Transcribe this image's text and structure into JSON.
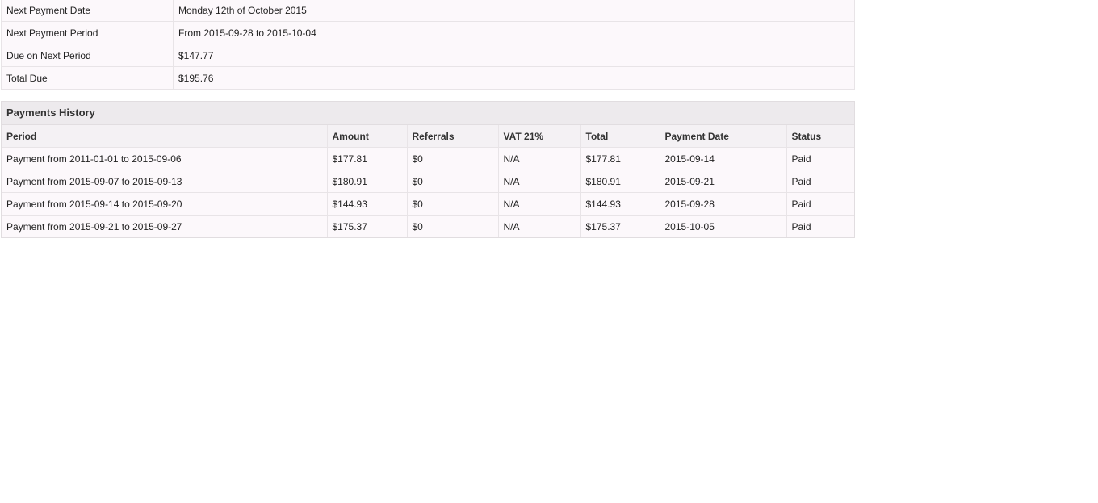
{
  "summary": {
    "rows": [
      {
        "label": "Next Payment Date",
        "value": "Monday 12th of October 2015"
      },
      {
        "label": "Next Payment Period",
        "value": "From 2015-09-28 to 2015-10-04"
      },
      {
        "label": "Due on Next Period",
        "value": "$147.77"
      },
      {
        "label": "Total Due",
        "value": "$195.76"
      }
    ]
  },
  "history": {
    "title": "Payments History",
    "headers": [
      "Period",
      "Amount",
      "Referrals",
      "VAT 21%",
      "Total",
      "Payment Date",
      "Status"
    ],
    "rows": [
      [
        "Payment from 2011-01-01 to 2015-09-06",
        "$177.81",
        "$0",
        "N/A",
        "$177.81",
        "2015-09-14",
        "Paid"
      ],
      [
        "Payment from 2015-09-07 to 2015-09-13",
        "$180.91",
        "$0",
        "N/A",
        "$180.91",
        "2015-09-21",
        "Paid"
      ],
      [
        "Payment from 2015-09-14 to 2015-09-20",
        "$144.93",
        "$0",
        "N/A",
        "$144.93",
        "2015-09-28",
        "Paid"
      ],
      [
        "Payment from 2015-09-21 to 2015-09-27",
        "$175.37",
        "$0",
        "N/A",
        "$175.37",
        "2015-10-05",
        "Paid"
      ]
    ]
  }
}
